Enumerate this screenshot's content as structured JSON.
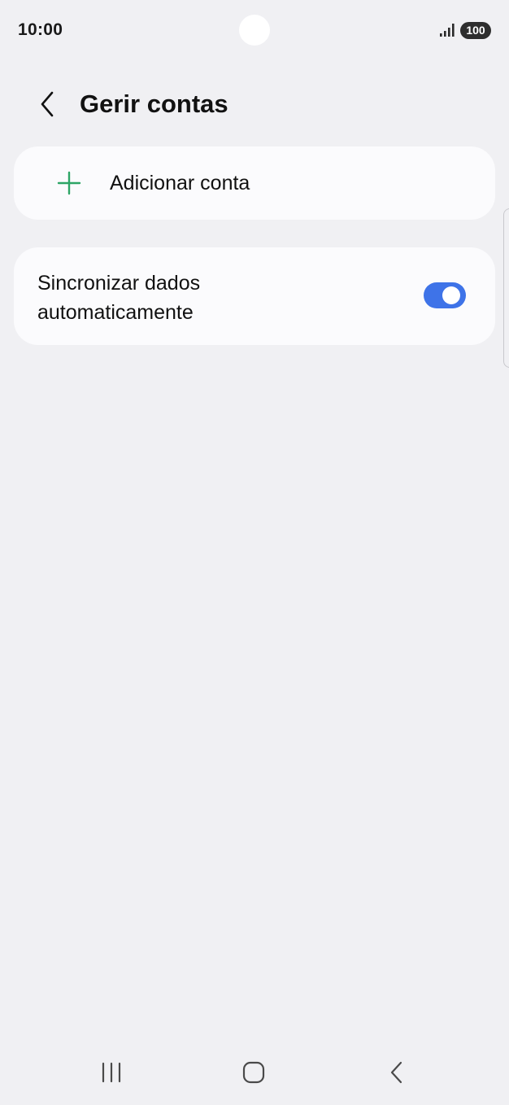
{
  "status_bar": {
    "time": "10:00",
    "battery": "100",
    "icons": [
      "signal-icon",
      "battery-icon"
    ]
  },
  "header": {
    "title": "Gerir contas",
    "back_icon": "chevron-left-icon"
  },
  "add_account": {
    "label": "Adicionar conta",
    "icon": "plus-icon"
  },
  "auto_sync": {
    "label": "Sincronizar dados automaticamente",
    "enabled": true
  },
  "nav_bar": {
    "icons": [
      "recents-icon",
      "home-icon",
      "back-icon"
    ]
  },
  "colors": {
    "background": "#f0f0f3",
    "card": "#fbfbfd",
    "accent_toggle": "#3e73e8",
    "plus_green": "#2da566"
  }
}
